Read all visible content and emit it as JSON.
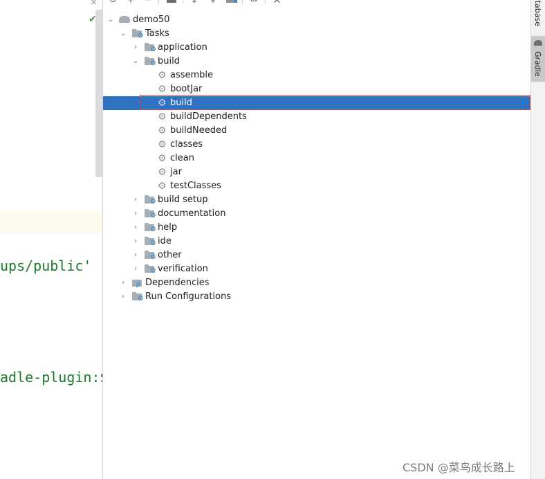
{
  "editor": {
    "close_glyph": "×",
    "check_glyph": "✔",
    "code_line_1": "ups/public'",
    "code_line_2_text": "adle-plugin:",
    "code_line_2_tail": "$"
  },
  "toolbar": {
    "refresh_icon": "↻",
    "add_icon": "+",
    "remove_icon": "−",
    "expand_all_icon": "⇟",
    "collapse_all_icon": "⇞",
    "wrench_icon": "🔧"
  },
  "tree": {
    "root": "demo50",
    "tasks": "Tasks",
    "groups": {
      "application": "application",
      "build": "build",
      "build_setup": "build setup",
      "documentation": "documentation",
      "help": "help",
      "ide": "ide",
      "other": "other",
      "verification": "verification"
    },
    "build_tasks": [
      "assemble",
      "bootJar",
      "build",
      "buildDependents",
      "buildNeeded",
      "classes",
      "clean",
      "jar",
      "testClasses"
    ],
    "dependencies": "Dependencies",
    "run_configurations": "Run Configurations",
    "selected_task": "build"
  },
  "strip": {
    "database_label": "atabase",
    "gradle_label": "Gradle"
  },
  "watermark": "CSDN @菜鸟成长路上",
  "colors": {
    "selection": "#2f72c2",
    "selection_outline": "#d24545",
    "code_string": "#1b7a2a"
  }
}
